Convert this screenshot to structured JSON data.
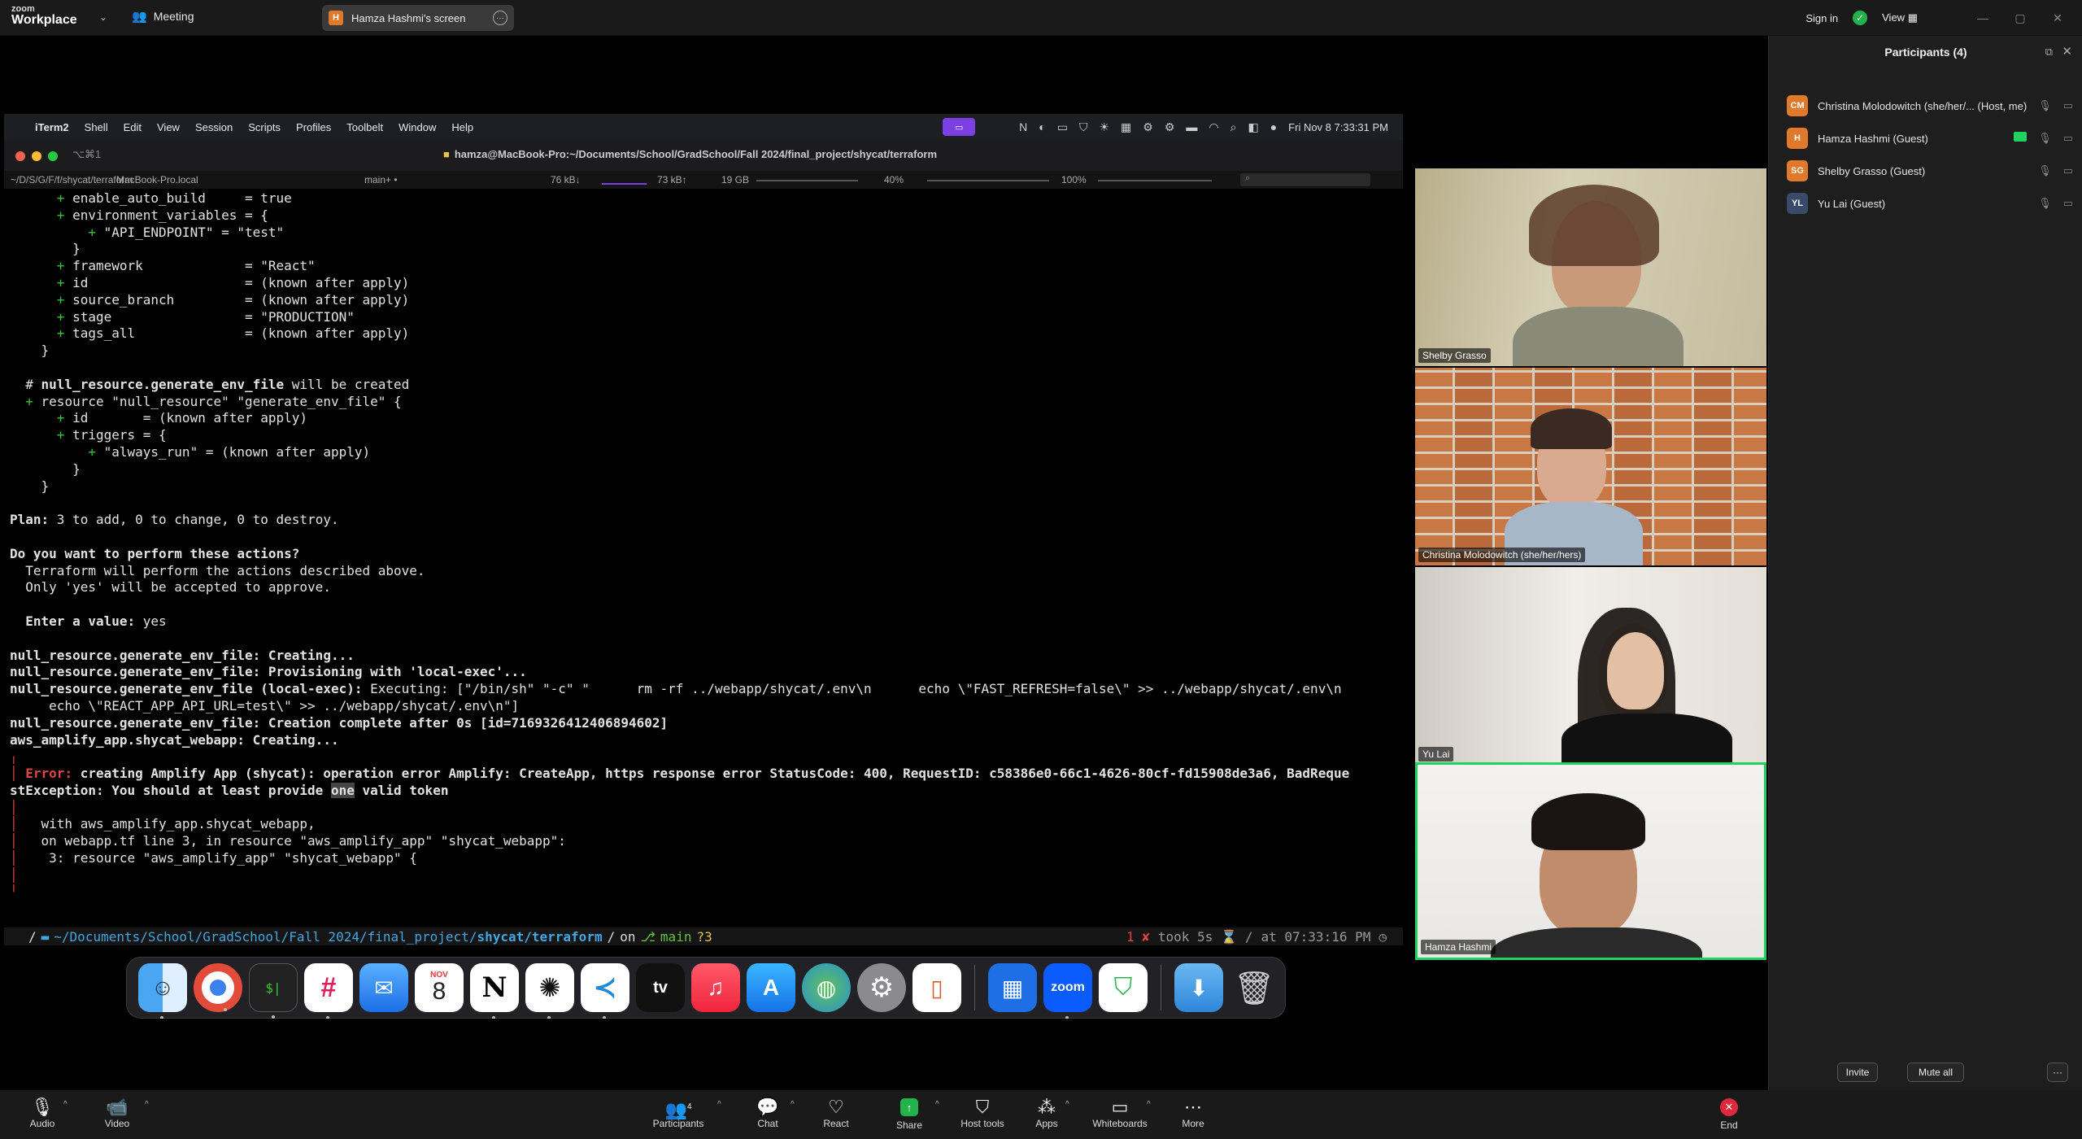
{
  "topbar": {
    "logo_line1": "zoom",
    "logo_line2": "Workplace",
    "meeting_label": "Meeting",
    "screen_tab_initial": "H",
    "screen_tab_label": "Hamza Hashmi's screen",
    "sign_in": "Sign in",
    "view": "View"
  },
  "mac_menubar": {
    "items": [
      "iTerm2",
      "Shell",
      "Edit",
      "View",
      "Session",
      "Scripts",
      "Profiles",
      "Toolbelt",
      "Window",
      "Help"
    ],
    "clock": "Fri Nov 8  7:33:31 PM"
  },
  "iterm": {
    "tab_label": "⌥⌘1",
    "title": "hamza@MacBook-Pro:~/Documents/School/GradSchool/Fall 2024/final_project/shycat/terraform",
    "status": {
      "path": "~/D/S/G/F/f/shycat/terraform",
      "host": "MacBook-Pro.local",
      "branch": "main+ •",
      "net_down": "76 kB↓",
      "net_up": "73 kB↑",
      "mem": "19 GB",
      "cpu": "40%",
      "battery": "100%"
    },
    "terminal_lines": [
      [
        {
          "t": "      "
        },
        {
          "t": "+",
          "c": "plus"
        },
        {
          "t": " enable_auto_build     = true"
        }
      ],
      [
        {
          "t": "      "
        },
        {
          "t": "+",
          "c": "plus"
        },
        {
          "t": " environment_variables = {"
        }
      ],
      [
        {
          "t": "          "
        },
        {
          "t": "+",
          "c": "plus"
        },
        {
          "t": " \"API_ENDPOINT\" = \"test\""
        }
      ],
      [
        {
          "t": "        }"
        }
      ],
      [
        {
          "t": "      "
        },
        {
          "t": "+",
          "c": "plus"
        },
        {
          "t": " framework             = \"React\""
        }
      ],
      [
        {
          "t": "      "
        },
        {
          "t": "+",
          "c": "plus"
        },
        {
          "t": " id                    = (known after apply)"
        }
      ],
      [
        {
          "t": "      "
        },
        {
          "t": "+",
          "c": "plus"
        },
        {
          "t": " source_branch         = (known after apply)"
        }
      ],
      [
        {
          "t": "      "
        },
        {
          "t": "+",
          "c": "plus"
        },
        {
          "t": " stage                 = \"PRODUCTION\""
        }
      ],
      [
        {
          "t": "      "
        },
        {
          "t": "+",
          "c": "plus"
        },
        {
          "t": " tags_all              = (known after apply)"
        }
      ],
      [
        {
          "t": "    }"
        }
      ],
      [
        {
          "t": ""
        }
      ],
      [
        {
          "t": "  # "
        },
        {
          "t": "null_resource.generate_env_file",
          "c": "bold"
        },
        {
          "t": " will be created"
        }
      ],
      [
        {
          "t": "  "
        },
        {
          "t": "+",
          "c": "plus"
        },
        {
          "t": " resource \"null_resource\" \"generate_env_file\" {"
        }
      ],
      [
        {
          "t": "      "
        },
        {
          "t": "+",
          "c": "plus"
        },
        {
          "t": " id       = (known after apply)"
        }
      ],
      [
        {
          "t": "      "
        },
        {
          "t": "+",
          "c": "plus"
        },
        {
          "t": " triggers = {"
        }
      ],
      [
        {
          "t": "          "
        },
        {
          "t": "+",
          "c": "plus"
        },
        {
          "t": " \"always_run\" = (known after apply)"
        }
      ],
      [
        {
          "t": "        }"
        }
      ],
      [
        {
          "t": "    }"
        }
      ],
      [
        {
          "t": ""
        }
      ],
      [
        {
          "t": "Plan:",
          "c": "bold"
        },
        {
          "t": " 3 to add, 0 to change, 0 to destroy."
        }
      ],
      [
        {
          "t": ""
        }
      ],
      [
        {
          "t": "Do you want to perform these actions?",
          "c": "bold"
        }
      ],
      [
        {
          "t": "  Terraform will perform the actions described above."
        }
      ],
      [
        {
          "t": "  Only 'yes' will be accepted to approve."
        }
      ],
      [
        {
          "t": ""
        }
      ],
      [
        {
          "t": "  "
        },
        {
          "t": "Enter a value:",
          "c": "bold"
        },
        {
          "t": " yes"
        }
      ],
      [
        {
          "t": ""
        }
      ],
      [
        {
          "t": "null_resource.generate_env_file: Creating...",
          "c": "bold"
        }
      ],
      [
        {
          "t": "null_resource.generate_env_file: Provisioning with 'local-exec'...",
          "c": "bold"
        }
      ],
      [
        {
          "t": "null_resource.generate_env_file (local-exec):",
          "c": "bold"
        },
        {
          "t": " Executing: [\"/bin/sh\" \"-c\" \"      rm -rf ../webapp/shycat/.env\\n      echo \\\"FAST_REFRESH=false\\\" >> ../webapp/shycat/.env\\n"
        }
      ],
      [
        {
          "t": "     echo \\\"REACT_APP_API_URL=test\\\" >> ../webapp/shycat/.env\\n\"]"
        }
      ],
      [
        {
          "t": "null_resource.generate_env_file: Creation complete after 0s [id=7169326412406894602]",
          "c": "bold"
        }
      ],
      [
        {
          "t": "aws_amplify_app.shycat_webapp: Creating...",
          "c": "bold"
        }
      ],
      [
        {
          "t": "╷",
          "c": "red"
        }
      ],
      [
        {
          "t": "│ ",
          "c": "red"
        },
        {
          "t": "Error: ",
          "c": "red bold"
        },
        {
          "t": "creating Amplify App (shycat): operation error Amplify: CreateApp, https response error StatusCode: 400, RequestID: c58386e0-66c1-4626-80cf-fd15908de3a6, BadReque",
          "c": "bold"
        }
      ],
      [
        {
          "t": "stException: You should at least provide ",
          "c": "bold"
        },
        {
          "t": "one",
          "c": "bold hl"
        },
        {
          "t": " valid token",
          "c": "bold"
        }
      ],
      [
        {
          "t": "│",
          "c": "red"
        }
      ],
      [
        {
          "t": "│ ",
          "c": "red"
        },
        {
          "t": "  with aws_amplify_app.shycat_webapp,"
        }
      ],
      [
        {
          "t": "│ ",
          "c": "red"
        },
        {
          "t": "  on webapp.tf line 3, in resource \"aws_amplify_app\" \"shycat_webapp\":"
        }
      ],
      [
        {
          "t": "│ ",
          "c": "red"
        },
        {
          "t": "   3: resource \"aws_amplify_app\" \"shycat_webapp\" {"
        }
      ],
      [
        {
          "t": "│",
          "c": "red"
        }
      ],
      [
        {
          "t": "╵",
          "c": "red"
        }
      ]
    ],
    "prompt": {
      "path_prefix": "~/Documents/School/GradSchool/Fall 2024/final_project/",
      "path_dir": "shycat/terraform",
      "on": "on",
      "branch": "main",
      "dirty": "?3",
      "exit": "1 ✘",
      "took": "took 5s ⌛",
      "at": "at 07:33:16 PM"
    }
  },
  "dock": {
    "calendar_month": "NOV",
    "calendar_day": "8",
    "zoom_label": "zoom"
  },
  "videos": [
    {
      "name": "Shelby Grasso"
    },
    {
      "name": "Christina Molodowitch (she/her/hers)"
    },
    {
      "name": "Yu Lai"
    },
    {
      "name": "Hamza Hashmi"
    }
  ],
  "participants": {
    "title": "Participants (4)",
    "list": [
      {
        "initials": "CM",
        "name": "Christina Molodowitch (she/her/...  (Host, me)",
        "color": "#e07a2a"
      },
      {
        "initials": "H",
        "name": "Hamza Hashmi (Guest)",
        "color": "#e07a2a"
      },
      {
        "initials": "SG",
        "name": "Shelby Grasso (Guest)",
        "color": "#e07a2a"
      },
      {
        "initials": "YL",
        "name": "Yu Lai (Guest)",
        "color": "#3a4a6a"
      }
    ],
    "invite": "Invite",
    "mute_all": "Mute all",
    "more": "···"
  },
  "toolbar": {
    "audio": "Audio",
    "video": "Video",
    "participants": "Participants",
    "participants_count": "4",
    "chat": "Chat",
    "react": "React",
    "share": "Share",
    "host_tools": "Host tools",
    "apps": "Apps",
    "whiteboards": "Whiteboards",
    "more": "More",
    "end": "End"
  },
  "colors": {
    "accent_green": "#23d160",
    "zoom_blue": "#0b5cff",
    "end_red": "#e0283c",
    "terminal_green": "#38c23d"
  }
}
